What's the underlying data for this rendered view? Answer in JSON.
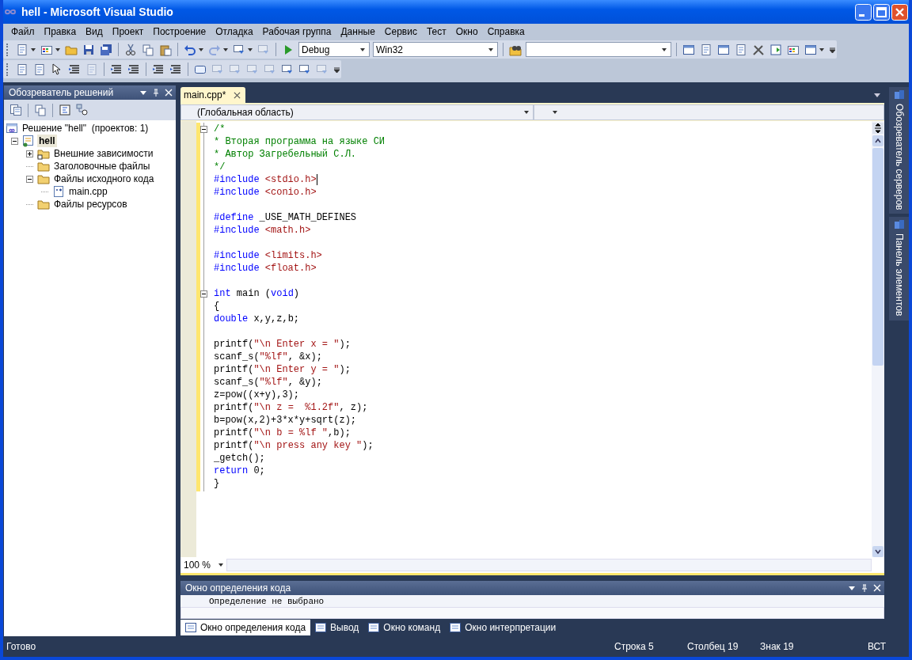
{
  "window": {
    "title": "hell - Microsoft Visual Studio"
  },
  "menu": [
    "Файл",
    "Правка",
    "Вид",
    "Проект",
    "Построение",
    "Отладка",
    "Рабочая группа",
    "Данные",
    "Сервис",
    "Тест",
    "Окно",
    "Справка"
  ],
  "toolbar": {
    "configuration": "Debug",
    "platform": "Win32"
  },
  "solution_explorer": {
    "title": "Обозреватель решений",
    "tree": [
      {
        "label": "Решение \"hell\"  (проектов: 1)",
        "kind": "solution",
        "selected": false,
        "children": [
          {
            "label": "hell",
            "kind": "project",
            "selected": true,
            "expanded": true,
            "children": [
              {
                "label": "Внешние зависимости",
                "kind": "folder-ref",
                "selected": false,
                "expanded": false
              },
              {
                "label": "Заголовочные файлы",
                "kind": "folder",
                "selected": false
              },
              {
                "label": "Файлы исходного кода",
                "kind": "folder",
                "selected": false,
                "expanded": true,
                "children": [
                  {
                    "label": "main.cpp",
                    "kind": "file",
                    "selected": false
                  }
                ]
              },
              {
                "label": "Файлы ресурсов",
                "kind": "folder",
                "selected": false
              }
            ]
          }
        ]
      }
    ]
  },
  "editor": {
    "tab": "main.cpp*",
    "scope": "(Глобальная область)",
    "zoom": "100 %",
    "lines": [
      {
        "kind": "code",
        "fold": true,
        "segs": [
          {
            "text": "/*",
            "kind": "comment"
          }
        ]
      },
      {
        "kind": "code",
        "fold": false,
        "segs": [
          {
            "text": "* Вторая программа на языке СИ",
            "kind": "comment"
          }
        ]
      },
      {
        "kind": "code",
        "fold": false,
        "segs": [
          {
            "text": "* Автор Загребельный С.Л.",
            "kind": "comment"
          }
        ]
      },
      {
        "kind": "code",
        "fold": false,
        "segs": [
          {
            "text": "*/",
            "kind": "comment"
          }
        ]
      },
      {
        "kind": "code",
        "fold": false,
        "segs": [
          {
            "text": "#include",
            "kind": "keyword"
          },
          {
            "text": " <stdio.h>",
            "kind": "string"
          },
          {
            "kind": "caret"
          }
        ]
      },
      {
        "kind": "code",
        "fold": false,
        "segs": [
          {
            "text": "#include",
            "kind": "keyword"
          },
          {
            "text": " <conio.h>",
            "kind": "string"
          }
        ]
      },
      {
        "kind": "blank"
      },
      {
        "kind": "code",
        "fold": false,
        "segs": [
          {
            "text": "#define",
            "kind": "keyword"
          },
          {
            "text": " _USE_MATH_DEFINES",
            "kind": "plain"
          }
        ]
      },
      {
        "kind": "code",
        "fold": false,
        "segs": [
          {
            "text": "#include",
            "kind": "keyword"
          },
          {
            "text": " <math.h>",
            "kind": "string"
          }
        ]
      },
      {
        "kind": "blank"
      },
      {
        "kind": "code",
        "fold": false,
        "segs": [
          {
            "text": "#include",
            "kind": "keyword"
          },
          {
            "text": " <limits.h>",
            "kind": "string"
          }
        ]
      },
      {
        "kind": "code",
        "fold": false,
        "segs": [
          {
            "text": "#include",
            "kind": "keyword"
          },
          {
            "text": " <float.h>",
            "kind": "string"
          }
        ]
      },
      {
        "kind": "blank"
      },
      {
        "kind": "code",
        "fold": true,
        "segs": [
          {
            "text": "int",
            "kind": "keyword"
          },
          {
            "text": " main (",
            "kind": "plain"
          },
          {
            "text": "void",
            "kind": "keyword"
          },
          {
            "text": ")",
            "kind": "plain"
          }
        ]
      },
      {
        "kind": "code",
        "fold": false,
        "segs": [
          {
            "text": "{",
            "kind": "plain"
          }
        ]
      },
      {
        "kind": "code",
        "fold": false,
        "segs": [
          {
            "text": "double",
            "kind": "keyword"
          },
          {
            "text": " x,y,z,b;",
            "kind": "plain"
          }
        ]
      },
      {
        "kind": "blank"
      },
      {
        "kind": "code",
        "fold": false,
        "segs": [
          {
            "text": "printf(",
            "kind": "plain"
          },
          {
            "text": "\"\\n Enter x = \"",
            "kind": "string"
          },
          {
            "text": ");",
            "kind": "plain"
          }
        ]
      },
      {
        "kind": "code",
        "fold": false,
        "segs": [
          {
            "text": "scanf_s(",
            "kind": "plain"
          },
          {
            "text": "\"%lf\"",
            "kind": "string"
          },
          {
            "text": ", &x);",
            "kind": "plain"
          }
        ]
      },
      {
        "kind": "code",
        "fold": false,
        "segs": [
          {
            "text": "printf(",
            "kind": "plain"
          },
          {
            "text": "\"\\n Enter y = \"",
            "kind": "string"
          },
          {
            "text": ");",
            "kind": "plain"
          }
        ]
      },
      {
        "kind": "code",
        "fold": false,
        "segs": [
          {
            "text": "scanf_s(",
            "kind": "plain"
          },
          {
            "text": "\"%lf\"",
            "kind": "string"
          },
          {
            "text": ", &y);",
            "kind": "plain"
          }
        ]
      },
      {
        "kind": "code",
        "fold": false,
        "segs": [
          {
            "text": "z=pow((x+y),3);",
            "kind": "plain"
          }
        ]
      },
      {
        "kind": "code",
        "fold": false,
        "segs": [
          {
            "text": "printf(",
            "kind": "plain"
          },
          {
            "text": "\"\\n z =  %1.2f\"",
            "kind": "string"
          },
          {
            "text": ", z);",
            "kind": "plain"
          }
        ]
      },
      {
        "kind": "code",
        "fold": false,
        "segs": [
          {
            "text": "b=pow(x,2)+3*x*y+sqrt(z);",
            "kind": "plain"
          }
        ]
      },
      {
        "kind": "code",
        "fold": false,
        "segs": [
          {
            "text": "printf(",
            "kind": "plain"
          },
          {
            "text": "\"\\n b = %lf \"",
            "kind": "string"
          },
          {
            "text": ",b);",
            "kind": "plain"
          }
        ]
      },
      {
        "kind": "code",
        "fold": false,
        "segs": [
          {
            "text": "printf(",
            "kind": "plain"
          },
          {
            "text": "\"\\n press any key \"",
            "kind": "string"
          },
          {
            "text": ");",
            "kind": "plain"
          }
        ]
      },
      {
        "kind": "code",
        "fold": false,
        "segs": [
          {
            "text": "_getch();",
            "kind": "plain"
          }
        ]
      },
      {
        "kind": "code",
        "fold": false,
        "segs": [
          {
            "text": "return",
            "kind": "keyword"
          },
          {
            "text": " 0;",
            "kind": "plain"
          }
        ]
      },
      {
        "kind": "code",
        "fold": false,
        "segs": [
          {
            "text": "}",
            "kind": "plain"
          }
        ]
      }
    ]
  },
  "code_definition": {
    "title": "Окно определения кода",
    "text": "Определение не выбрано"
  },
  "bottom_tabs": [
    {
      "label": "Окно определения кода",
      "selected": true
    },
    {
      "label": "Вывод",
      "selected": false
    },
    {
      "label": "Окно команд",
      "selected": false
    },
    {
      "label": "Окно интерпретации",
      "selected": false
    }
  ],
  "side_tabs": [
    "Обозреватель серверов",
    "Панель элементов"
  ],
  "status_bar": {
    "message": "Готово",
    "line": "Строка 5",
    "column": "Столбец 19",
    "char": "Знак 19",
    "mode": "ВСТ"
  }
}
